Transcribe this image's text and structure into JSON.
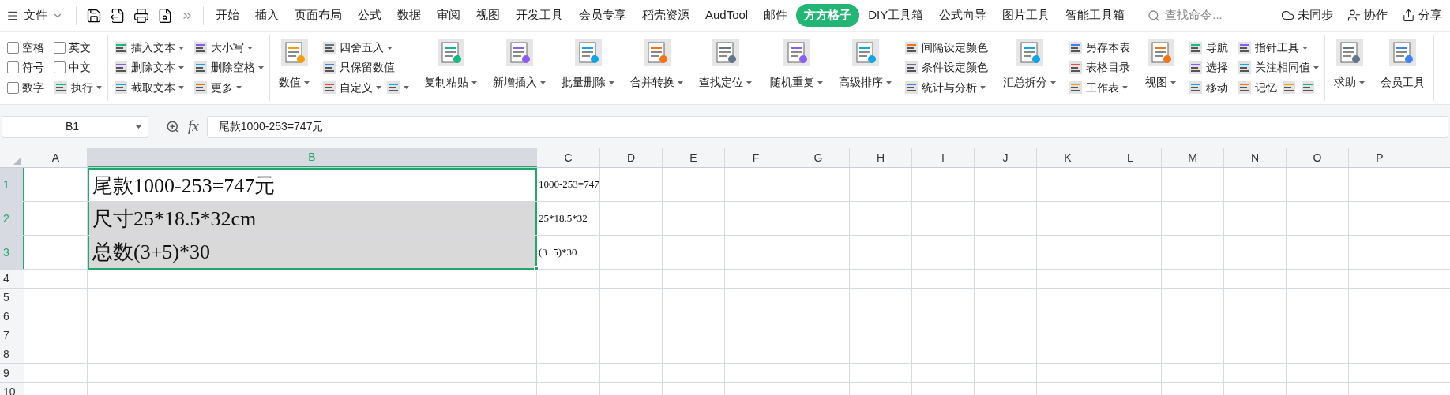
{
  "menu": {
    "file": "文件",
    "tabs": [
      {
        "label": "开始",
        "selected": false
      },
      {
        "label": "插入",
        "selected": false
      },
      {
        "label": "页面布局",
        "selected": false
      },
      {
        "label": "公式",
        "selected": false
      },
      {
        "label": "数据",
        "selected": false
      },
      {
        "label": "审阅",
        "selected": false
      },
      {
        "label": "视图",
        "selected": false
      },
      {
        "label": "开发工具",
        "selected": false
      },
      {
        "label": "会员专享",
        "selected": false
      },
      {
        "label": "稻壳资源",
        "selected": false
      },
      {
        "label": "AudTool",
        "selected": false
      },
      {
        "label": "邮件",
        "selected": false
      },
      {
        "label": "方方格子",
        "selected": true
      },
      {
        "label": "DIY工具箱",
        "selected": false
      },
      {
        "label": "公式向导",
        "selected": false
      },
      {
        "label": "图片工具",
        "selected": false
      },
      {
        "label": "智能工具箱",
        "selected": false
      }
    ],
    "search": {
      "placeholder": "查找命令..."
    },
    "actions": [
      "未同步",
      "协作",
      "分享"
    ]
  },
  "ribbon": [
    {
      "columns": [
        {
          "kind": "stack",
          "rows": [
            [
              {
                "kind": "checkbox",
                "label": "空格",
                "checked": false
              }
            ],
            [
              {
                "kind": "checkbox",
                "label": "符号",
                "checked": false
              }
            ],
            [
              {
                "kind": "checkbox",
                "label": "数字",
                "checked": false
              }
            ]
          ]
        },
        {
          "kind": "stack",
          "rows": [
            [
              {
                "kind": "checkbox",
                "label": "英文",
                "checked": false
              }
            ],
            [
              {
                "kind": "checkbox",
                "label": "中文",
                "checked": false
              }
            ],
            [
              {
                "kind": "button",
                "label": "执行",
                "dropdown": true
              }
            ]
          ]
        }
      ]
    },
    {
      "columns": [
        {
          "kind": "stack",
          "rows": [
            [
              {
                "kind": "button",
                "label": "插入文本",
                "dropdown": true
              }
            ],
            [
              {
                "kind": "button",
                "label": "删除文本",
                "dropdown": true
              }
            ],
            [
              {
                "kind": "button",
                "label": "截取文本",
                "dropdown": true
              }
            ]
          ]
        },
        {
          "kind": "stack",
          "rows": [
            [
              {
                "kind": "button",
                "label": "大小写",
                "dropdown": true
              }
            ],
            [
              {
                "kind": "button",
                "label": "删除空格",
                "dropdown": true
              }
            ],
            [
              {
                "kind": "button",
                "label": "更多",
                "dropdown": true
              }
            ]
          ]
        }
      ]
    },
    {
      "columns": [
        {
          "kind": "large",
          "label": "数值",
          "dropdown": true
        },
        {
          "kind": "stack",
          "rows": [
            [
              {
                "kind": "button",
                "label": "四舍五入",
                "dropdown": true
              }
            ],
            [
              {
                "kind": "button",
                "label": "只保留数值",
                "dropdown": false
              }
            ],
            [
              {
                "kind": "button",
                "label": "自定义",
                "dropdown": true
              },
              {
                "kind": "icon",
                "dropdown": true
              }
            ]
          ]
        }
      ]
    },
    {
      "columns": [
        {
          "kind": "large",
          "label": "复制粘贴",
          "dropdown": true
        },
        {
          "kind": "large",
          "label": "新增插入",
          "dropdown": true
        },
        {
          "kind": "large",
          "label": "批量删除",
          "dropdown": true
        },
        {
          "kind": "large",
          "label": "合并转换",
          "dropdown": true
        },
        {
          "kind": "large",
          "label": "查找定位",
          "dropdown": true
        }
      ]
    },
    {
      "columns": [
        {
          "kind": "large",
          "label": "随机重复",
          "dropdown": true
        },
        {
          "kind": "large",
          "label": "高级排序",
          "dropdown": true
        },
        {
          "kind": "stack",
          "rows": [
            [
              {
                "kind": "button",
                "label": "间隔设定颜色",
                "dropdown": false
              }
            ],
            [
              {
                "kind": "button",
                "label": "条件设定颜色",
                "dropdown": false
              }
            ],
            [
              {
                "kind": "button",
                "label": "统计与分析",
                "dropdown": true
              }
            ]
          ]
        }
      ]
    },
    {
      "columns": [
        {
          "kind": "large",
          "label": "汇总拆分",
          "dropdown": true
        },
        {
          "kind": "stack",
          "rows": [
            [
              {
                "kind": "button",
                "label": "另存本表",
                "dropdown": false
              }
            ],
            [
              {
                "kind": "button",
                "label": "表格目录",
                "dropdown": false
              }
            ],
            [
              {
                "kind": "button",
                "label": "工作表",
                "dropdown": true
              }
            ]
          ]
        }
      ]
    },
    {
      "columns": [
        {
          "kind": "large",
          "label": "视图",
          "dropdown": true
        },
        {
          "kind": "stack",
          "rows": [
            [
              {
                "kind": "button",
                "label": "导航",
                "dropdown": false
              }
            ],
            [
              {
                "kind": "button",
                "label": "选择",
                "dropdown": false
              }
            ],
            [
              {
                "kind": "button",
                "label": "移动",
                "dropdown": false
              }
            ]
          ]
        },
        {
          "kind": "stack",
          "rows": [
            [
              {
                "kind": "button",
                "label": "指针工具",
                "dropdown": true
              }
            ],
            [
              {
                "kind": "button",
                "label": "关注相同值",
                "dropdown": true
              }
            ],
            [
              {
                "kind": "button",
                "label": "记忆",
                "dropdown": false
              },
              {
                "kind": "icon",
                "dropdown": false
              },
              {
                "kind": "icon",
                "dropdown": false
              }
            ]
          ]
        }
      ]
    },
    {
      "columns": [
        {
          "kind": "large",
          "label": "求助",
          "dropdown": true
        },
        {
          "kind": "large",
          "label": "会员工具",
          "dropdown": false
        }
      ]
    }
  ],
  "formula_bar": {
    "name_box": "B1",
    "fx": "fx",
    "formula": "尾款1000-253=747元"
  },
  "columns": [
    {
      "label": "A",
      "selected": false
    },
    {
      "label": "B",
      "selected": true
    },
    {
      "label": "C",
      "selected": false
    },
    {
      "label": "D",
      "selected": false
    },
    {
      "label": "E",
      "selected": false
    },
    {
      "label": "F",
      "selected": false
    },
    {
      "label": "G",
      "selected": false
    },
    {
      "label": "H",
      "selected": false
    },
    {
      "label": "I",
      "selected": false
    },
    {
      "label": "J",
      "selected": false
    },
    {
      "label": "K",
      "selected": false
    },
    {
      "label": "L",
      "selected": false
    },
    {
      "label": "M",
      "selected": false
    },
    {
      "label": "N",
      "selected": false
    },
    {
      "label": "O",
      "selected": false
    },
    {
      "label": "P",
      "selected": false
    }
  ],
  "rows": [
    {
      "label": "1",
      "selected": true,
      "b": "尾款1000-253=747元",
      "c": "1000-253=747"
    },
    {
      "label": "2",
      "selected": true,
      "b": "尺寸25*18.5*32cm",
      "c": "25*18.5*32"
    },
    {
      "label": "3",
      "selected": true,
      "b": "总数(3+5)*30",
      "c": "(3+5)*30"
    },
    {
      "label": "4",
      "selected": false
    },
    {
      "label": "5",
      "selected": false
    },
    {
      "label": "6",
      "selected": false
    },
    {
      "label": "7",
      "selected": false
    },
    {
      "label": "8",
      "selected": false
    },
    {
      "label": "9",
      "selected": false
    },
    {
      "label": "10",
      "selected": false
    }
  ]
}
